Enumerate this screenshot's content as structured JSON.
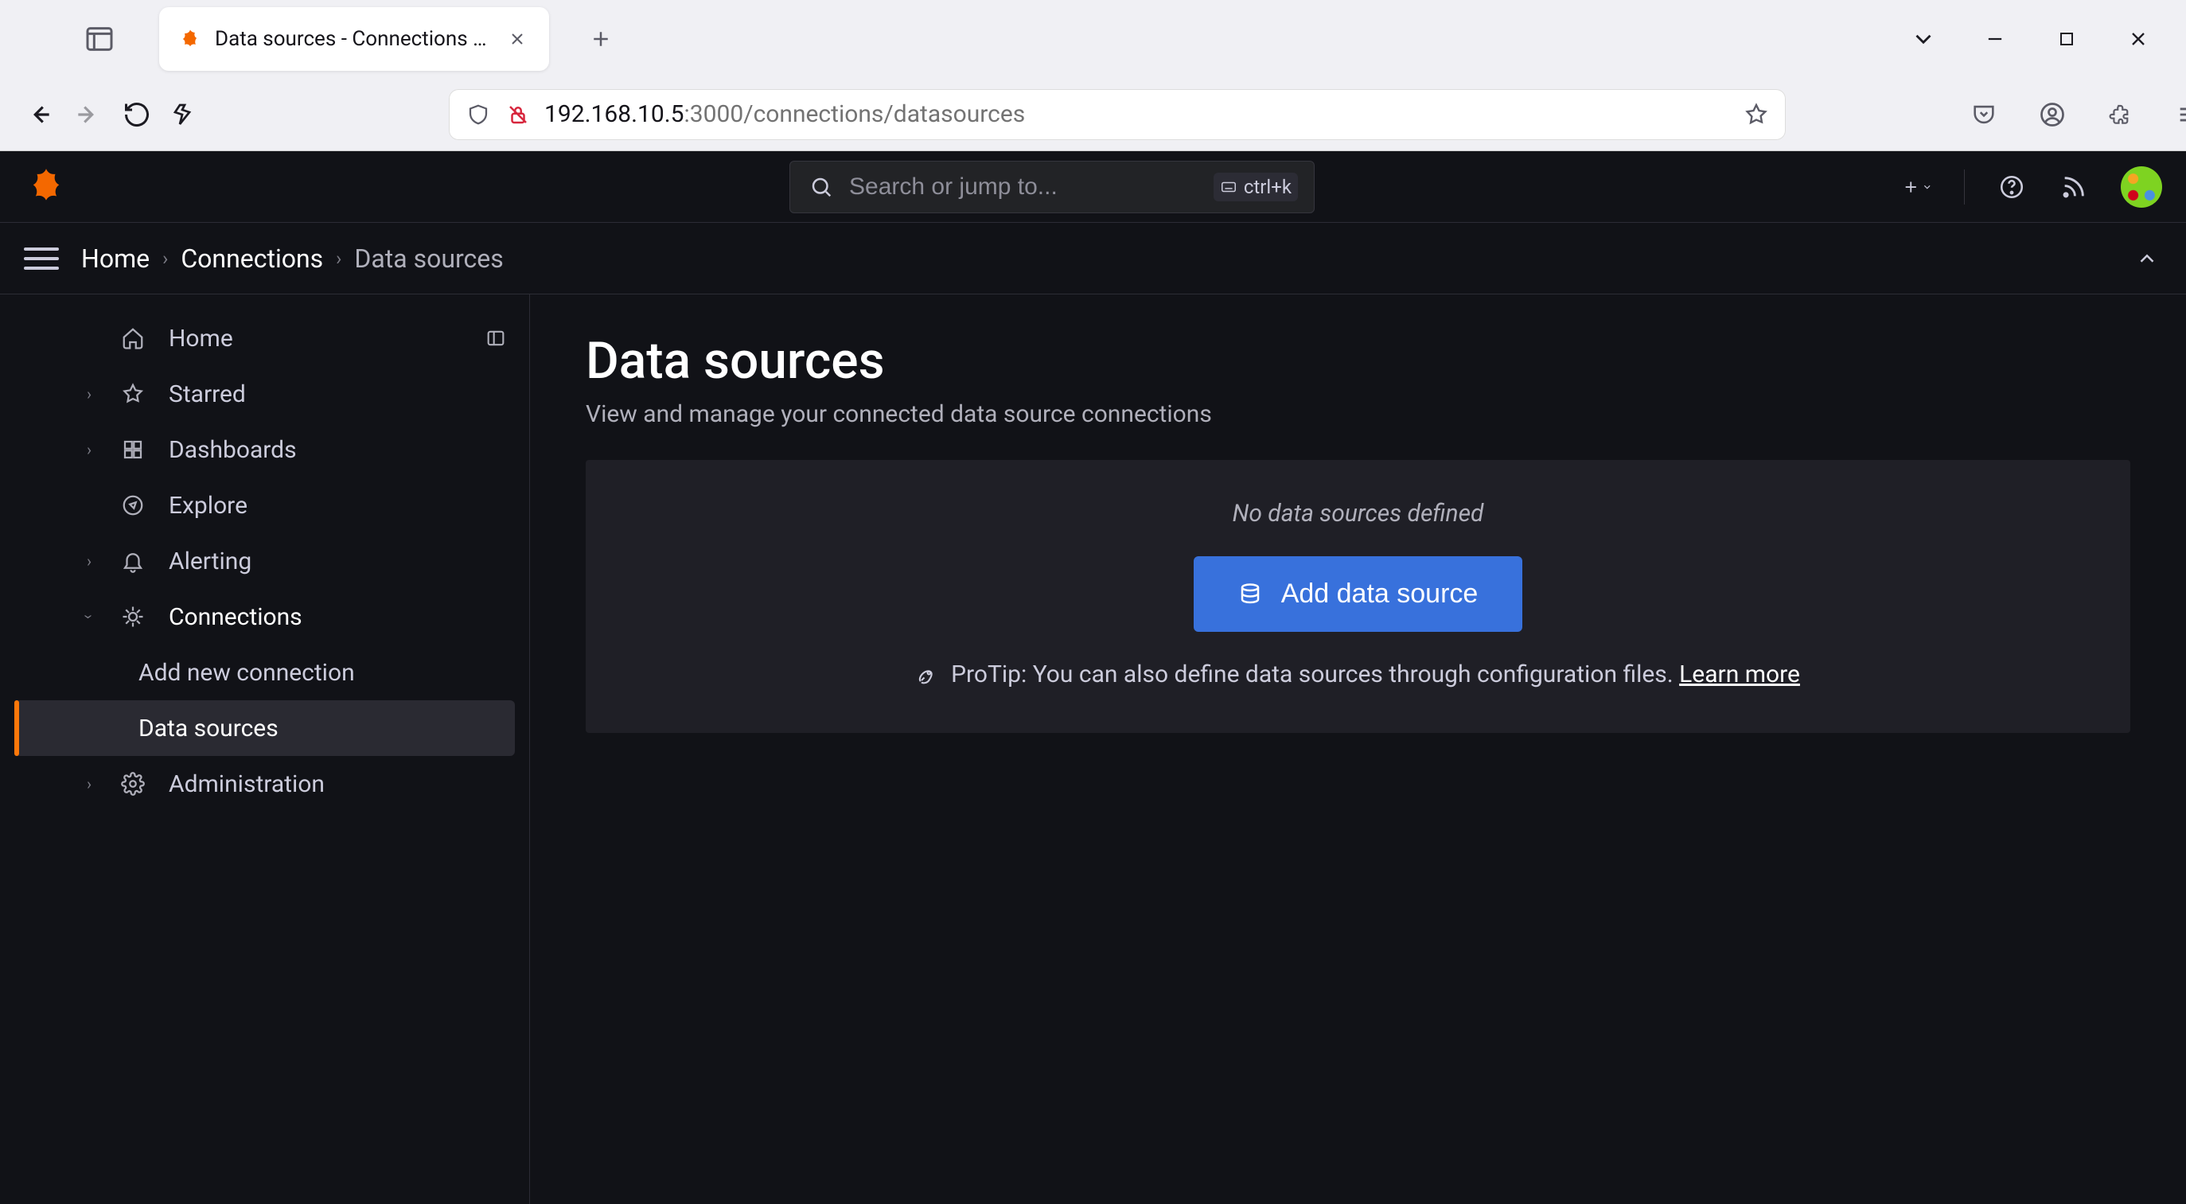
{
  "browser": {
    "tab_title": "Data sources - Connections - G",
    "url_host": "192.168.10.5",
    "url_path": ":3000/connections/datasources"
  },
  "header": {
    "search_placeholder": "Search or jump to...",
    "shortcut": "ctrl+k"
  },
  "breadcrumb": {
    "items": [
      "Home",
      "Connections",
      "Data sources"
    ]
  },
  "sidebar": {
    "items": [
      {
        "label": "Home",
        "icon": "home",
        "expand": null
      },
      {
        "label": "Starred",
        "icon": "star",
        "expand": "right"
      },
      {
        "label": "Dashboards",
        "icon": "apps",
        "expand": "right"
      },
      {
        "label": "Explore",
        "icon": "compass",
        "expand": null
      },
      {
        "label": "Alerting",
        "icon": "bell",
        "expand": "right"
      },
      {
        "label": "Connections",
        "icon": "plug",
        "expand": "down",
        "children": [
          {
            "label": "Add new connection"
          },
          {
            "label": "Data sources",
            "selected": true
          }
        ]
      },
      {
        "label": "Administration",
        "icon": "cog",
        "expand": "right"
      }
    ]
  },
  "page": {
    "title": "Data sources",
    "subtitle": "View and manage your connected data source connections",
    "empty_message": "No data sources defined",
    "add_button": "Add data source",
    "protip_prefix": "ProTip: You can also define data sources through configuration files. ",
    "protip_link": "Learn more"
  }
}
